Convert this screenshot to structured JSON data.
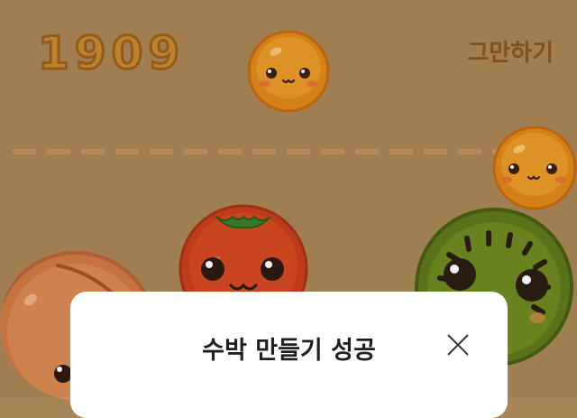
{
  "game": {
    "score": "1909",
    "quit_label": "그만하기"
  },
  "fruits": {
    "current": "orange",
    "next": "orange",
    "on_board": [
      "peach",
      "tomato",
      "kiwi"
    ]
  },
  "modal": {
    "title": "수박 만들기 성공",
    "close_icon": "close-icon"
  },
  "colors": {
    "background": "#a88556",
    "score": "#c88a30",
    "quit": "#8a5520",
    "modal": "#ffffff"
  }
}
